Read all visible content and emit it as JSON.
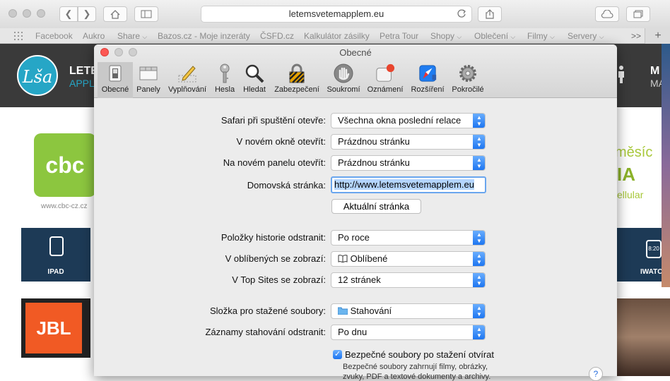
{
  "browser": {
    "address": "letemsvetemapplem.eu",
    "favorites": [
      "Facebook",
      "Aukro",
      "Share",
      "Bazos.cz - Moje inzeráty",
      "ČSFD.cz",
      "Kalkulátor zásilky",
      "Petra Tour",
      "Shopy",
      "Oblečení",
      "Filmy",
      "Servery"
    ],
    "overflow": ">>",
    "add_tab": "+"
  },
  "background_site": {
    "logo_text": "Lša",
    "header_text_1": "LETE",
    "header_text_2": "APPLE",
    "header_right_1": "M",
    "header_right_2": "MA",
    "cbc_logo": "cbc",
    "cbc_caption": "www.cbc-cz.cz",
    "ipad_label": "IPAD",
    "iwatch_label": "IWATC",
    "iwatch_time": "8:20",
    "jbl_label": "JBL",
    "promo_text_1": "měsíc",
    "promo_text_2": "IA",
    "promo_text_3": "ellular"
  },
  "preferences": {
    "title": "Obecné",
    "tabs": [
      {
        "label": "Obecné",
        "icon": "general-switch-icon"
      },
      {
        "label": "Panely",
        "icon": "tabs-icon"
      },
      {
        "label": "Vyplňování",
        "icon": "pencil-icon"
      },
      {
        "label": "Hesla",
        "icon": "key-icon"
      },
      {
        "label": "Hledat",
        "icon": "magnifier-icon"
      },
      {
        "label": "Zabezpečení",
        "icon": "padlock-icon"
      },
      {
        "label": "Soukromí",
        "icon": "hand-icon"
      },
      {
        "label": "Oznámení",
        "icon": "notification-icon"
      },
      {
        "label": "Rozšíření",
        "icon": "extension-compass-icon"
      },
      {
        "label": "Pokročilé",
        "icon": "gear-icon"
      }
    ],
    "rows": {
      "startup": {
        "label": "Safari při spuštění otevře:",
        "value": "Všechna okna poslední relace"
      },
      "new_window": {
        "label": "V novém okně otevřít:",
        "value": "Prázdnou stránku"
      },
      "new_tab": {
        "label": "Na novém panelu otevřít:",
        "value": "Prázdnou stránku"
      },
      "homepage": {
        "label": "Domovská stránka:",
        "value": "http://www.letemsvetemapplem.eu"
      },
      "current_page_button": "Aktuální stránka",
      "history": {
        "label": "Položky historie odstranit:",
        "value": "Po roce"
      },
      "favorites": {
        "label": "V oblíbených se zobrazí:",
        "value": "Oblíbené"
      },
      "top_sites": {
        "label": "V Top Sites se zobrazí:",
        "value": "12 stránek"
      },
      "downloads_folder": {
        "label": "Složka pro stažené soubory:",
        "value": "Stahování"
      },
      "downloads_remove": {
        "label": "Záznamy stahování odstranit:",
        "value": "Po dnu"
      }
    },
    "safe_files": {
      "checked": true,
      "label": "Bezpečné soubory po stažení otvírat",
      "desc_1": "Bezpečné soubory zahrnují filmy, obrázky,",
      "desc_2": "zvuky, PDF a textové dokumenty a archivy."
    },
    "help": "?"
  },
  "colors": {
    "accent": "#1a73f0",
    "close_button": "#fc5753",
    "site_header": "#3a3a3a",
    "cbc_green": "#8cc63f",
    "jbl_orange": "#f15a24",
    "tile_navy": "#1d3a56"
  }
}
